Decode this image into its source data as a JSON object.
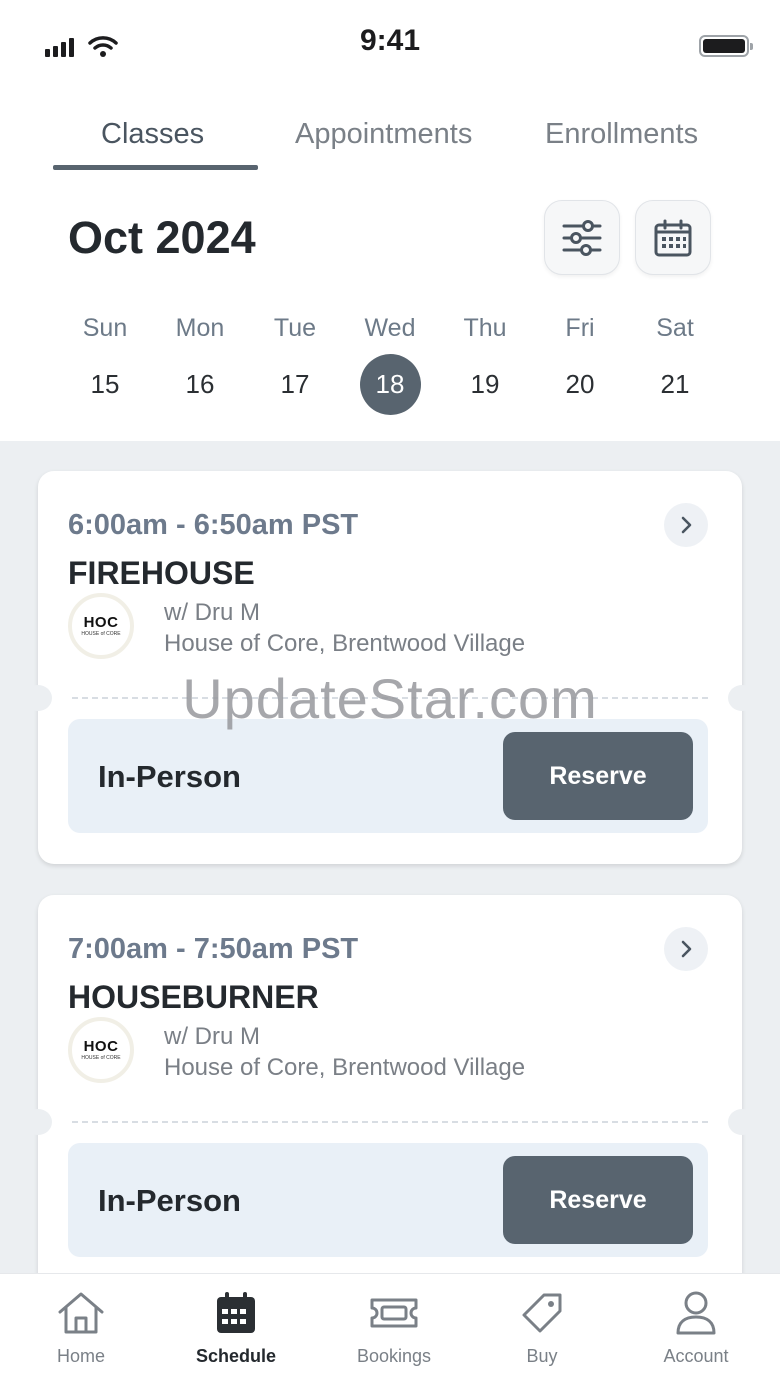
{
  "status_bar": {
    "time": "9:41"
  },
  "tabs": [
    {
      "label": "Classes",
      "active": true
    },
    {
      "label": "Appointments",
      "active": false
    },
    {
      "label": "Enrollments",
      "active": false
    }
  ],
  "calendar": {
    "month": "Oct 2024",
    "filter_icon": "sliders-icon",
    "calendar_icon": "calendar-icon",
    "days": [
      {
        "name": "Sun",
        "num": "15"
      },
      {
        "name": "Mon",
        "num": "16"
      },
      {
        "name": "Tue",
        "num": "17"
      },
      {
        "name": "Wed",
        "num": "18",
        "selected": true
      },
      {
        "name": "Thu",
        "num": "19"
      },
      {
        "name": "Fri",
        "num": "20"
      },
      {
        "name": "Sat",
        "num": "21"
      }
    ]
  },
  "classes": [
    {
      "time": "6:00am - 6:50am PST",
      "title": "FIREHOUSE",
      "logo_text": "HOC",
      "logo_sub": "HOUSE of CORE",
      "instructor": "w/ Dru M",
      "location": "House of Core, Brentwood Village",
      "type": "In-Person",
      "action": "Reserve"
    },
    {
      "time": "7:00am - 7:50am PST",
      "title": "HOUSEBURNER",
      "logo_text": "HOC",
      "logo_sub": "HOUSE of CORE",
      "instructor": "w/ Dru M",
      "location": "House of Core, Brentwood Village",
      "type": "In-Person",
      "action": "Reserve"
    }
  ],
  "watermark": "UpdateStar.com",
  "bottom_nav": [
    {
      "label": "Home",
      "icon": "home-icon",
      "active": false
    },
    {
      "label": "Schedule",
      "icon": "calendar-icon",
      "active": true
    },
    {
      "label": "Bookings",
      "icon": "ticket-icon",
      "active": false
    },
    {
      "label": "Buy",
      "icon": "tag-icon",
      "active": false
    },
    {
      "label": "Account",
      "icon": "user-icon",
      "active": false
    }
  ],
  "colors": {
    "accent": "#58646f",
    "list_background": "#eceff2",
    "panel_background": "#e9f0f7",
    "time_text": "#6d7a8c"
  }
}
